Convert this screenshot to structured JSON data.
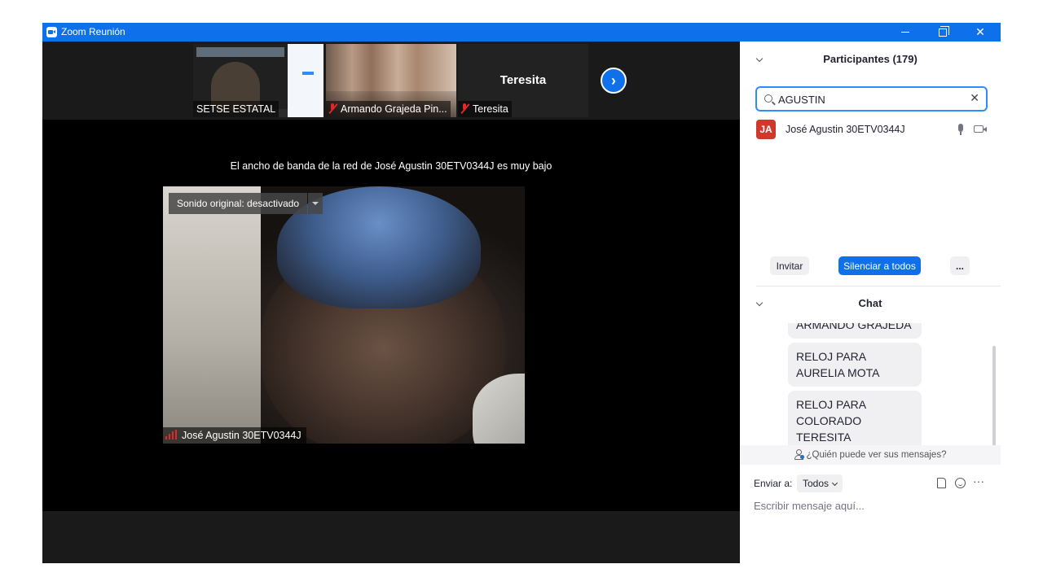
{
  "window": {
    "title": "Zoom Reunión"
  },
  "thumbnails": [
    {
      "name": "SETSE ESTATAL"
    },
    {
      "name": "Armando Grajeda Pin..."
    },
    {
      "name": "Teresita",
      "center_name": "Teresita"
    }
  ],
  "stage": {
    "bandwidth_notice": "El ancho de banda de la red de José Agustin 30ETV0344J es muy bajo",
    "original_sound": "Sonido original: desactivado",
    "speaker_name": "José Agustin 30ETV0344J"
  },
  "participants": {
    "header": "Participantes (179)",
    "search_value": "AGUSTIN",
    "items": [
      {
        "initials": "JA",
        "name": "José Agustin 30ETV0344J",
        "avatar_color": "#d2372c"
      }
    ],
    "invite_label": "Invitar",
    "mute_all_label": "Silenciar a todos",
    "more_label": "..."
  },
  "chat": {
    "header": "Chat",
    "messages": [
      "ARMANDO GRAJEDA",
      "RELOJ PARA AURELIA MOTA",
      "RELOJ PARA COLORADO TERESITA"
    ],
    "who_can_see": "¿Quién puede ver sus mensajes?",
    "send_to_label": "Enviar a:",
    "send_to_value": "Todos",
    "compose_placeholder": "Escribir mensaje aquí..."
  },
  "colors": {
    "accent": "#0e71eb",
    "muted_red": "#e02828"
  }
}
